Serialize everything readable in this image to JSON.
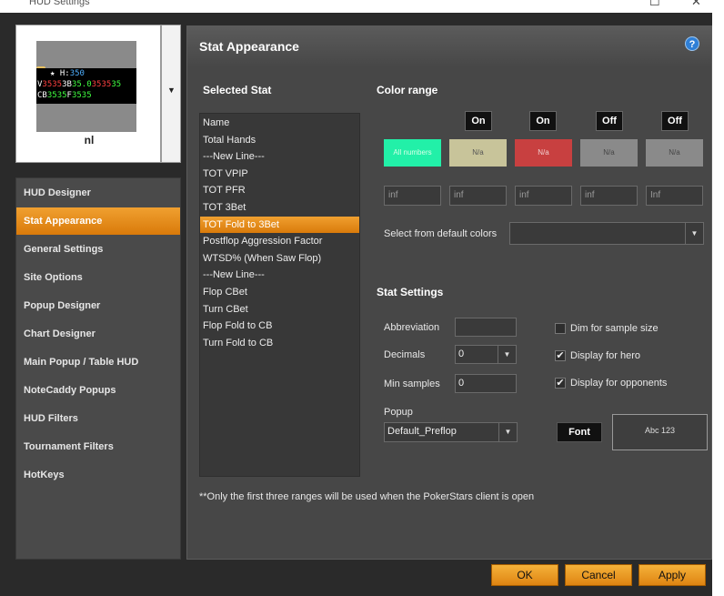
{
  "window": {
    "title": "HUD Settings",
    "minimize": "—",
    "maximize": "☐",
    "close": "✕"
  },
  "preview": {
    "name": "nl",
    "hud_line1": [
      {
        "t": "★ ",
        "c": "#ffffff"
      },
      {
        "t": "H:",
        "c": "#ffffff"
      },
      {
        "t": "350",
        "c": "#4fb0ff"
      }
    ],
    "hud_line2": [
      {
        "t": "V",
        "c": "#ffffff"
      },
      {
        "t": "35",
        "c": "#ff4040"
      },
      {
        "t": "35",
        "c": "#ff4040"
      },
      {
        "t": "3B",
        "c": "#ffffff"
      },
      {
        "t": "35.0",
        "c": "#40ff40"
      },
      {
        "t": "35",
        "c": "#ff4040"
      },
      {
        "t": "35",
        "c": "#ff4040"
      },
      {
        "t": "35",
        "c": "#40ff40"
      }
    ],
    "hud_line3": [
      {
        "t": "CB",
        "c": "#ffffff"
      },
      {
        "t": "35",
        "c": "#40ff40"
      },
      {
        "t": "35",
        "c": "#40ff40"
      },
      {
        "t": "F",
        "c": "#ffffff"
      },
      {
        "t": "35",
        "c": "#40ff40"
      },
      {
        "t": "35",
        "c": "#40ff40"
      }
    ]
  },
  "sidebar": {
    "items": [
      {
        "label": "HUD Designer"
      },
      {
        "label": "Stat Appearance"
      },
      {
        "label": "General Settings"
      },
      {
        "label": "Site Options"
      },
      {
        "label": "Popup Designer"
      },
      {
        "label": "Chart Designer"
      },
      {
        "label": "Main Popup / Table HUD"
      },
      {
        "label": "NoteCaddy Popups"
      },
      {
        "label": "HUD Filters"
      },
      {
        "label": "Tournament Filters"
      },
      {
        "label": "HotKeys"
      }
    ],
    "active_index": 1
  },
  "panel": {
    "title": "Stat Appearance",
    "help": "?",
    "selected_stat_label": "Selected Stat",
    "stats": [
      "Name",
      "Total Hands",
      "---New Line---",
      "TOT VPIP",
      "TOT PFR",
      "TOT 3Bet",
      "TOT Fold to 3Bet",
      "Postflop Aggression Factor",
      "WTSD% (When Saw Flop)",
      "---New Line---",
      "Flop CBet",
      "Turn CBet",
      "Flop Fold to CB",
      "Turn Fold to CB"
    ],
    "selected_stat_index": 6,
    "color_range_label": "Color range",
    "toggles": [
      "On",
      "On",
      "Off",
      "Off"
    ],
    "swatches": [
      {
        "label": "All numbers",
        "bg": "#22f0a8",
        "fg": "#d8ffe8"
      },
      {
        "label": "N/a",
        "bg": "#c8c49a",
        "fg": "#555"
      },
      {
        "label": "N/a",
        "bg": "#c84040",
        "fg": "#f0d0d0"
      },
      {
        "label": "N/a",
        "bg": "#8a8a8a",
        "fg": "#444"
      },
      {
        "label": "N/a",
        "bg": "#8a8a8a",
        "fg": "#444"
      }
    ],
    "ranges": [
      "inf",
      "inf",
      "inf",
      "inf",
      "Inf"
    ],
    "default_colors_label": "Select from default colors",
    "default_colors_value": "",
    "stat_settings_label": "Stat Settings",
    "abbreviation_label": "Abbreviation",
    "abbreviation_value": "",
    "decimals_label": "Decimals",
    "decimals_value": "0",
    "min_samples_label": "Min samples",
    "min_samples_value": "0",
    "popup_label": "Popup",
    "popup_value": "Default_Preflop",
    "dim_label": "Dim for sample size",
    "hero_label": "Display for hero",
    "opponents_label": "Display for opponents",
    "dim_checked": false,
    "hero_checked": true,
    "opponents_checked": true,
    "font_button": "Font",
    "font_sample": "Abc 123",
    "note": "**Only the first three ranges will be used when the PokerStars client is open"
  },
  "buttons": {
    "ok": "OK",
    "cancel": "Cancel",
    "apply": "Apply"
  }
}
